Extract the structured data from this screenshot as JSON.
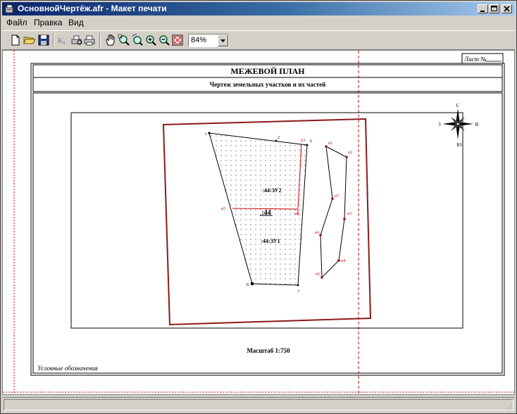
{
  "window": {
    "title": "ОсновнойЧертёж.afr - Макет печати"
  },
  "menu": {
    "file": "Файл",
    "edit": "Правка",
    "view": "Вид"
  },
  "toolbar": {
    "zoom": "84%"
  },
  "sheet": {
    "sheet_label": "Лист №",
    "title": "МЕЖЕВОЙ ПЛАН",
    "subtitle": "Чертеж земельных участков и их частей",
    "scale": "Масштаб 1:750",
    "legend": "Условные обозначения"
  },
  "drawing": {
    "parcel_main": ":44",
    "part_upper": ":44:ЗУ2",
    "part_lower": ":44:ЗУ1",
    "points": {
      "p1": "1",
      "p2": "2",
      "p6": "6",
      "p7": "7",
      "p8": "8"
    },
    "new_points": {
      "n1": "н1",
      "n2": "н2",
      "n3": "н3",
      "n4": "н4",
      "n5": "н5",
      "n6": "н6",
      "n7": "н7",
      "n8": "н8",
      "m3": "н3",
      "m4": "н4",
      "m5": "н5"
    },
    "compass": {
      "north": "С",
      "south": "Ю",
      "west": "З",
      "east": "В"
    }
  },
  "colors": {
    "border": "#8b1a1a",
    "red": "#cc0000",
    "titlebar": "#0a246a"
  }
}
